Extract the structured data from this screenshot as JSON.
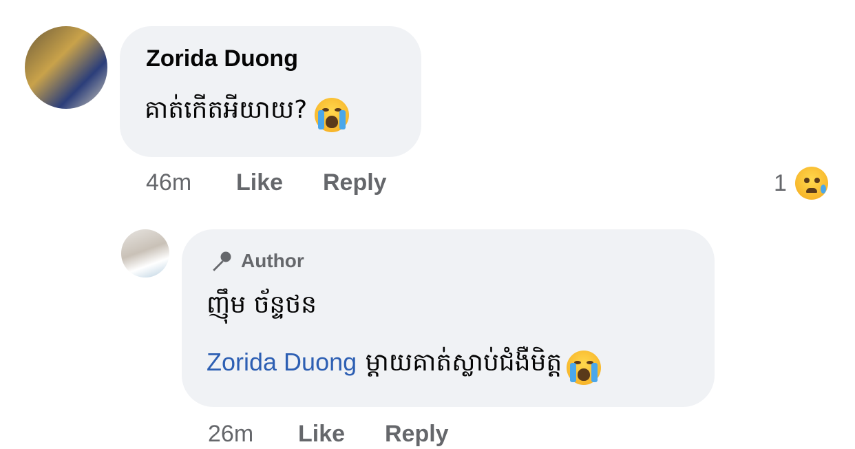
{
  "comment": {
    "author": "Zorida Duong",
    "text": "គាត់កើតអីយាយ?",
    "emoji": "loudly-crying-face",
    "time": "46m",
    "like_label": "Like",
    "reply_label": "Reply",
    "reaction_count": "1",
    "reaction_emoji": "sad-but-relieved-face"
  },
  "reply": {
    "badge_label": "Author",
    "badge_icon": "microphone-icon",
    "author": "ញ៉ឹម ច័ន្ទថន",
    "mention": "Zorida Duong",
    "text": "ម្ដាយគាត់ស្លាប់ជំងឺមិត្ត",
    "emoji": "loudly-crying-face",
    "time": "26m",
    "like_label": "Like",
    "reply_label": "Reply"
  },
  "colors": {
    "bubble": "#f0f2f5",
    "meta": "#65676b",
    "mention": "#2d5fb3"
  }
}
